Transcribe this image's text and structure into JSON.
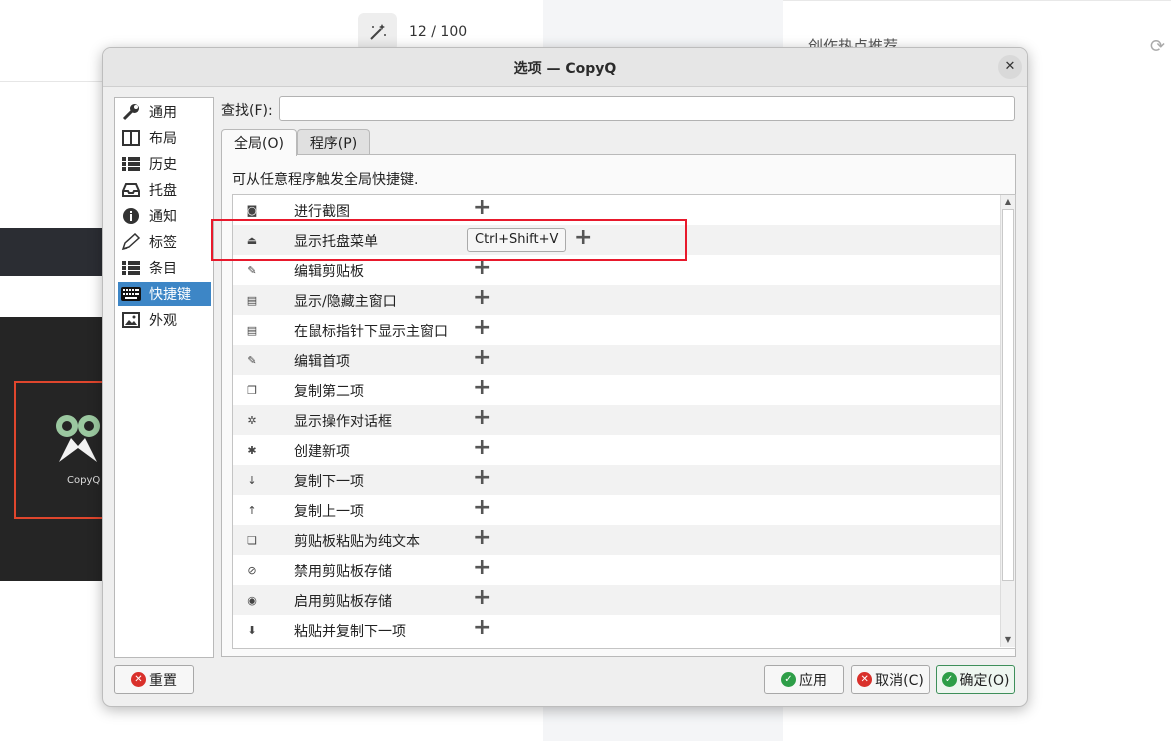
{
  "background": {
    "counter_text": "12 / 100",
    "hot_title": "创作热点推荐",
    "logo_label": "CopyQ",
    "magic_icon": "magic-wand-icon",
    "refresh_icon": "refresh-icon"
  },
  "dialog": {
    "title": "选项 — CopyQ",
    "close_label": "✕",
    "search_label": "查找(F):",
    "search_value": "",
    "tabs": [
      {
        "label": "全局(O)"
      },
      {
        "label": "程序(P)"
      }
    ],
    "description": "可从任意程序触发全局快捷键.",
    "sidebar": [
      {
        "label": "通用",
        "icon": "wrench-icon"
      },
      {
        "label": "布局",
        "icon": "columns-icon"
      },
      {
        "label": "历史",
        "icon": "list-icon"
      },
      {
        "label": "托盘",
        "icon": "tray-icon"
      },
      {
        "label": "通知",
        "icon": "info-icon"
      },
      {
        "label": "标签",
        "icon": "tag-pen-icon"
      },
      {
        "label": "条目",
        "icon": "items-icon"
      },
      {
        "label": "快捷键",
        "icon": "keyboard-icon"
      },
      {
        "label": "外观",
        "icon": "image-icon"
      }
    ],
    "shortcuts": [
      {
        "name": "进行截图",
        "icon": "camera-icon",
        "key": ""
      },
      {
        "name": "显示托盘菜单",
        "icon": "tray-icon",
        "key": "Ctrl+Shift+V"
      },
      {
        "name": "编辑剪贴板",
        "icon": "edit-icon",
        "key": ""
      },
      {
        "name": "显示/隐藏主窗口",
        "icon": "window-list-icon",
        "key": ""
      },
      {
        "name": "在鼠标指针下显示主窗口",
        "icon": "window-list-icon",
        "key": ""
      },
      {
        "name": "编辑首项",
        "icon": "edit-icon",
        "key": ""
      },
      {
        "name": "复制第二项",
        "icon": "copy-icon",
        "key": ""
      },
      {
        "name": "显示操作对话框",
        "icon": "gear-icon",
        "key": ""
      },
      {
        "name": "创建新项",
        "icon": "asterisk-icon",
        "key": ""
      },
      {
        "name": "复制下一项",
        "icon": "arrow-down-icon",
        "key": ""
      },
      {
        "name": "复制上一项",
        "icon": "arrow-up-icon",
        "key": ""
      },
      {
        "name": "剪贴板粘贴为纯文本",
        "icon": "paste-icon",
        "key": ""
      },
      {
        "name": "禁用剪贴板存储",
        "icon": "eye-slash-icon",
        "key": ""
      },
      {
        "name": "启用剪贴板存储",
        "icon": "eye-icon",
        "key": ""
      },
      {
        "name": "粘贴并复制下一项",
        "icon": "circle-down-icon",
        "key": ""
      }
    ],
    "add_symbol": "+",
    "buttons": {
      "reset": "重置",
      "apply": "应用",
      "cancel": "取消(C)",
      "ok": "确定(O)"
    }
  }
}
